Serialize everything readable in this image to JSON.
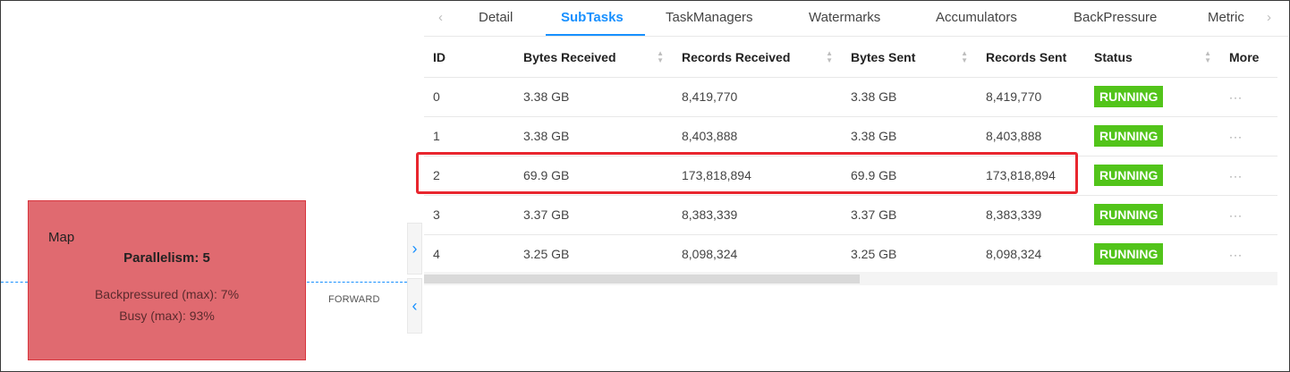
{
  "graph": {
    "node": {
      "title": "Map",
      "parallelism": "Parallelism: 5",
      "backpressured": "Backpressured (max): 7%",
      "busy": "Busy (max): 93%"
    },
    "edge_label": "FORWARD"
  },
  "tabs": {
    "items": [
      "Detail",
      "SubTasks",
      "TaskManagers",
      "Watermarks",
      "Accumulators",
      "BackPressure",
      "Metric"
    ],
    "active": "SubTasks"
  },
  "table": {
    "headers": [
      "ID",
      "Bytes Received",
      "Records Received",
      "Bytes Sent",
      "Records Sent",
      "Status",
      "More"
    ],
    "rows": [
      {
        "id": "0",
        "bytes_received": "3.38 GB",
        "records_received": "8,419,770",
        "bytes_sent": "3.38 GB",
        "records_sent": "8,419,770",
        "status": "RUNNING",
        "more": "···"
      },
      {
        "id": "1",
        "bytes_received": "3.38 GB",
        "records_received": "8,403,888",
        "bytes_sent": "3.38 GB",
        "records_sent": "8,403,888",
        "status": "RUNNING",
        "more": "···"
      },
      {
        "id": "2",
        "bytes_received": "69.9 GB",
        "records_received": "173,818,894",
        "bytes_sent": "69.9 GB",
        "records_sent": "173,818,894",
        "status": "RUNNING",
        "more": "···"
      },
      {
        "id": "3",
        "bytes_received": "3.37 GB",
        "records_received": "8,383,339",
        "bytes_sent": "3.37 GB",
        "records_sent": "8,383,339",
        "status": "RUNNING",
        "more": "···"
      },
      {
        "id": "4",
        "bytes_received": "3.25 GB",
        "records_received": "8,098,324",
        "bytes_sent": "3.25 GB",
        "records_sent": "8,098,324",
        "status": "RUNNING",
        "more": "···"
      }
    ]
  },
  "colors": {
    "accent": "#1890ff",
    "node_fill": "#e06a70",
    "status_running": "#52c41a",
    "highlight": "#e8262e"
  },
  "icons": {
    "tab_prev": "chevron-left-icon",
    "tab_next": "chevron-right-icon",
    "expand": "chevron-right-icon",
    "collapse": "chevron-left-icon"
  }
}
